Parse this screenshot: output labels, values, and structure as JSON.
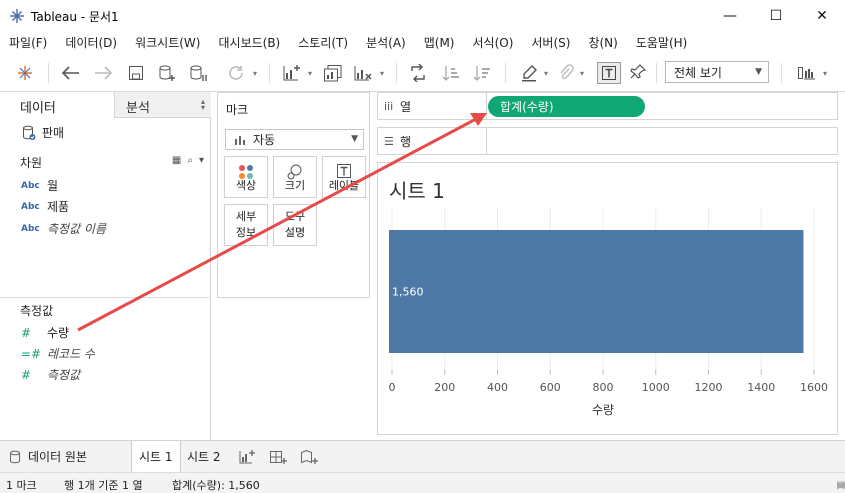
{
  "window": {
    "title": "Tableau - 문서1",
    "minimize": "—",
    "maximize": "☐",
    "close": "✕"
  },
  "menu": [
    "파일(F)",
    "데이터(D)",
    "워크시트(W)",
    "대시보드(B)",
    "스토리(T)",
    "분석(A)",
    "맵(M)",
    "서식(O)",
    "서버(S)",
    "창(N)",
    "도움말(H)"
  ],
  "toolbar": {
    "fit_label": "전체 보기",
    "icons": [
      "tableau-logo-icon",
      "back-arrow-icon",
      "forward-arrow-icon",
      "save-icon",
      "new-datasource-icon",
      "pause-updates-icon",
      "refresh-icon",
      "new-worksheet-icon",
      "duplicate-sheet-icon",
      "clear-sheet-icon",
      "swap-rows-columns-icon",
      "sort-ascending-icon",
      "sort-descending-icon",
      "highlight-icon",
      "group-icon",
      "show-labels-icon",
      "pin-axes-icon",
      "show-me-icon"
    ]
  },
  "left_pane": {
    "tab_data": "데이터",
    "tab_analysis": "분석",
    "datasource": "판매",
    "dimensions_header": "차원",
    "dimensions": [
      {
        "type": "Abc",
        "name": "월",
        "italic": false
      },
      {
        "type": "Abc",
        "name": "제품",
        "italic": false
      },
      {
        "type": "Abc",
        "name": "측정값 이름",
        "italic": true
      }
    ],
    "measures_header": "측정값",
    "measures": [
      {
        "type": "#",
        "name": "수량",
        "italic": false
      },
      {
        "type": "=#",
        "name": "레코드 수",
        "italic": true
      },
      {
        "type": "#",
        "name": "측정값",
        "italic": true
      }
    ]
  },
  "marks": {
    "title": "마크",
    "type": "자동",
    "buttons": [
      "색상",
      "크기",
      "레이블"
    ],
    "detail": [
      "세부",
      "정보"
    ],
    "tooltip": [
      "도구",
      "설명"
    ]
  },
  "shelves": {
    "columns_label": "열",
    "rows_label": "행",
    "columns_pill": "합계(수량)"
  },
  "viz": {
    "sheet_title": "시트 1"
  },
  "chart_data": {
    "type": "bar",
    "orientation": "horizontal",
    "categories": [
      ""
    ],
    "values": [
      1560
    ],
    "data_labels": [
      "1,560"
    ],
    "xlabel": "수량",
    "xticks": [
      "0",
      "200",
      "400",
      "600",
      "800",
      "1000",
      "1200",
      "1400",
      "1600"
    ],
    "xlim": [
      0,
      1600
    ],
    "bar_color": "#4e79a7",
    "grid": true
  },
  "sheet_tabs": {
    "datasource": "데이터 원본",
    "tabs": [
      "시트 1",
      "시트 2"
    ],
    "active": "시트 1"
  },
  "status": {
    "marks": "1 마크",
    "rows_cols": "행 1개 기준 1 열",
    "sum": "합계(수량): 1,560"
  },
  "colors": {
    "pill": "#0fa875",
    "bar": "#4e79a7",
    "arrow": "#e84a4a",
    "dimension": "#3a67a8",
    "measure": "#1a9e6a"
  }
}
